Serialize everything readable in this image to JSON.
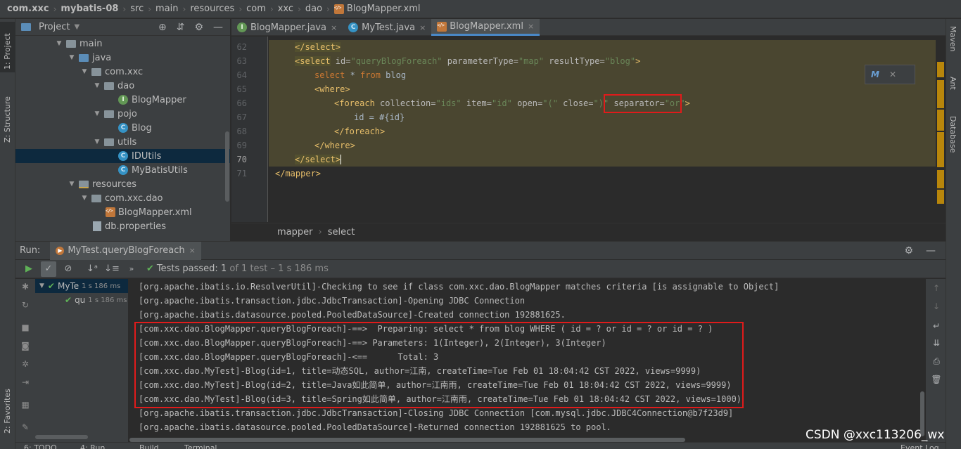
{
  "navbar": {
    "crumbs": [
      "com.xxc",
      "mybatis-08",
      "src",
      "main",
      "resources",
      "com",
      "xxc",
      "dao",
      "BlogMapper.xml"
    ]
  },
  "left_stripe": {
    "project": "1: Project",
    "structure": "Z: Structure",
    "favorites": "2: Favorites"
  },
  "right_stripe": {
    "maven": "Maven",
    "ant": "Ant",
    "database": "Database"
  },
  "project_panel": {
    "title": "Project",
    "items": [
      {
        "label": "main"
      },
      {
        "label": "java"
      },
      {
        "label": "com.xxc"
      },
      {
        "label": "dao"
      },
      {
        "label": "BlogMapper"
      },
      {
        "label": "pojo"
      },
      {
        "label": "Blog"
      },
      {
        "label": "utils"
      },
      {
        "label": "IDUtils"
      },
      {
        "label": "MyBatisUtils"
      },
      {
        "label": "resources"
      },
      {
        "label": "com.xxc.dao"
      },
      {
        "label": "BlogMapper.xml"
      },
      {
        "label": "db.properties"
      }
    ]
  },
  "editor_tabs": [
    {
      "label": "BlogMapper.java",
      "icon": "interface-icon"
    },
    {
      "label": "MyTest.java",
      "icon": "class-icon"
    },
    {
      "label": "BlogMapper.xml",
      "icon": "xml-icon"
    }
  ],
  "editor": {
    "line_numbers": [
      "62",
      "63",
      "64",
      "65",
      "66",
      "67",
      "68",
      "69",
      "70",
      "71"
    ],
    "current_line": "70",
    "l62": {
      "tag": "</select>"
    },
    "l63": {
      "open": "<select",
      "a1": " id=",
      "v1": "\"queryBlogForeach\"",
      "a2": " parameterType=",
      "v2": "\"map\"",
      "a3": " resultType=",
      "v3": "\"blog\"",
      "close": ">"
    },
    "l64": {
      "kw1": "select",
      "mid": " * ",
      "kw2": "from",
      "rest": " blog"
    },
    "l65": {
      "tag": "<where>"
    },
    "l66": {
      "open": "<foreach",
      "a1": " collection=",
      "v1": "\"ids\"",
      "a2": " item=",
      "v2": "\"id\"",
      "a3": " open=",
      "v3": "\"(\"",
      "a4": " close=",
      "v4": "\")\"",
      "a5": " separator=",
      "v5": "\"or\"",
      "close": ">"
    },
    "l67": {
      "text": "id = #{id}"
    },
    "l68": {
      "tag": "</foreach>"
    },
    "l69": {
      "tag": "</where>"
    },
    "l70": {
      "tag": "</select>"
    },
    "l71": {
      "tag": "</mapper>"
    },
    "popup_icon": "mybatis-icon"
  },
  "editor_breadcrumb": [
    "mapper",
    "select"
  ],
  "run_panel": {
    "label": "Run:",
    "tab": "MyTest.queryBlogForeach",
    "status_prefix": "Tests passed:",
    "status_count": "1",
    "status_rest": "of 1 test – 1 s 186 ms",
    "tree": [
      {
        "label": "MyTe",
        "time": "1 s 186 ms"
      },
      {
        "label": "qu",
        "time": "1 s 186 ms"
      }
    ],
    "console": [
      "[org.apache.ibatis.io.ResolverUtil]-Checking to see if class com.xxc.dao.BlogMapper matches criteria [is assignable to Object]",
      "[org.apache.ibatis.transaction.jdbc.JdbcTransaction]-Opening JDBC Connection",
      "[org.apache.ibatis.datasource.pooled.PooledDataSource]-Created connection 192881625.",
      "[com.xxc.dao.BlogMapper.queryBlogForeach]-==>  Preparing: select * from blog WHERE ( id = ? or id = ? or id = ? )",
      "[com.xxc.dao.BlogMapper.queryBlogForeach]-==> Parameters: 1(Integer), 2(Integer), 3(Integer)",
      "[com.xxc.dao.BlogMapper.queryBlogForeach]-<==      Total: 3",
      "[com.xxc.dao.MyTest]-Blog(id=1, title=动态SQL, author=江南, createTime=Tue Feb 01 18:04:42 CST 2022, views=9999)",
      "[com.xxc.dao.MyTest]-Blog(id=2, title=Java如此简单, author=江南雨, createTime=Tue Feb 01 18:04:42 CST 2022, views=9999)",
      "[com.xxc.dao.MyTest]-Blog(id=3, title=Spring如此简单, author=江南雨, createTime=Tue Feb 01 18:04:42 CST 2022, views=1000)",
      "[org.apache.ibatis.transaction.jdbc.JdbcTransaction]-Closing JDBC Connection [com.mysql.jdbc.JDBC4Connection@b7f23d9]",
      "[org.apache.ibatis.datasource.pooled.PooledDataSource]-Returned connection 192881625 to pool."
    ]
  },
  "statusbar": {
    "todo": "6: TODO",
    "run": "4: Run",
    "build": "Build",
    "terminal": "Terminal",
    "eventlog": "Event Log"
  },
  "watermark": "CSDN @xxc113206_wx",
  "colors": {
    "highlight_box": "#e01b1b",
    "tag": "#e8bf6a",
    "string": "#6a8759",
    "keyword": "#cc7832",
    "pass": "#5fb157"
  }
}
